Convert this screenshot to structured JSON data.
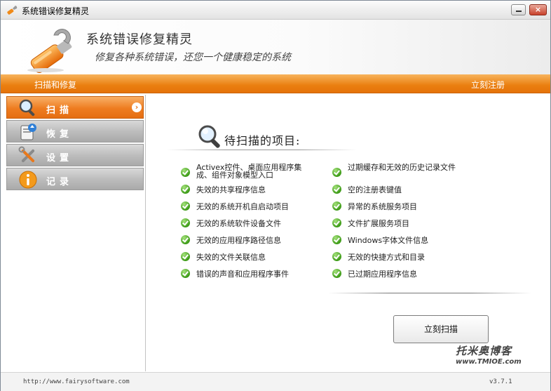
{
  "window": {
    "title": "系统错误修复精灵",
    "minimize_glyph": "",
    "close_glyph": "×"
  },
  "banner": {
    "app_name": "系统错误修复精灵",
    "tagline": "修复各种系统错误，还您一个健康稳定的系统"
  },
  "toolbar": {
    "breadcrumb": "扫描和修复",
    "register_label": "立刻注册"
  },
  "sidebar": {
    "items": [
      {
        "label": "扫描",
        "icon": "magnifier-icon",
        "active": true
      },
      {
        "label": "恢复",
        "icon": "restore-icon",
        "active": false
      },
      {
        "label": "设置",
        "icon": "tools-icon",
        "active": false
      },
      {
        "label": "记录",
        "icon": "info-icon",
        "active": false
      }
    ],
    "active_arrow": "›"
  },
  "scan_panel": {
    "title": "待扫描的项目:",
    "left_items": [
      "Activex控件、桌面应用程序集成、组件对象模型入口",
      "失效的共享程序信息",
      "无效的系统开机自启动项目",
      "无效的系统软件设备文件",
      "无效的应用程序路径信息",
      "失效的文件关联信息",
      "错误的声音和应用程序事件"
    ],
    "right_items": [
      "过期缓存和无效的历史记录文件",
      "空的注册表键值",
      "异常的系统服务项目",
      "文件扩展服务项目",
      "Windows字体文件信息",
      "无效的快捷方式和目录",
      "已过期应用程序信息"
    ],
    "scan_button_label": "立刻扫描"
  },
  "watermark": {
    "text": "托米奥博客",
    "url": "www.TMIOE.com"
  },
  "statusbar": {
    "website": "http://www.fairysoftware.com",
    "version": "v3.7.1"
  },
  "colors": {
    "accent": "#ea7f10",
    "check": "#3c9a16"
  }
}
